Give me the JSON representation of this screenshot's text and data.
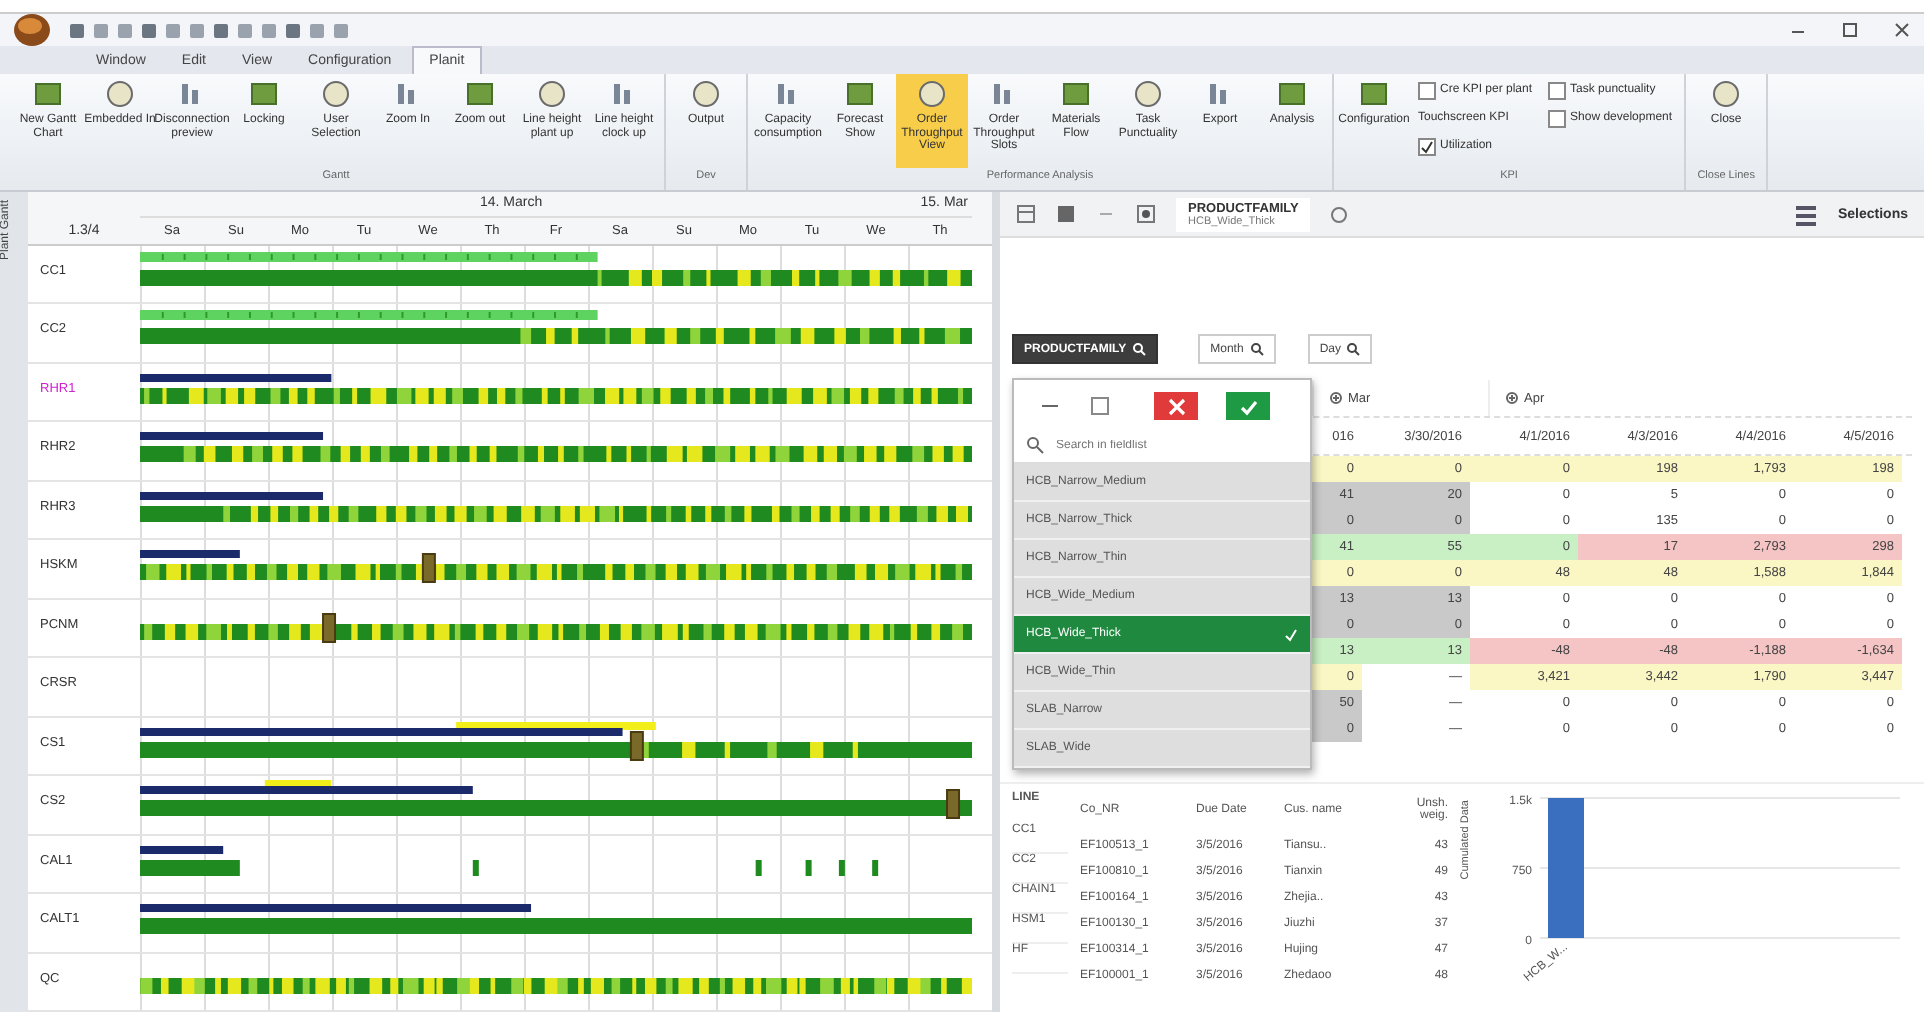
{
  "menu_tabs": [
    {
      "label": "Window",
      "selected": false
    },
    {
      "label": "Edit",
      "selected": false
    },
    {
      "label": "View",
      "selected": false
    },
    {
      "label": "Configuration",
      "selected": false
    },
    {
      "label": "Planit",
      "selected": true
    }
  ],
  "ribbon_groups": [
    {
      "title": "Gantt",
      "items": [
        {
          "kind": "button",
          "label": "New Gantt Chart",
          "active": false
        },
        {
          "kind": "button",
          "label": "Embedded In",
          "active": false
        },
        {
          "kind": "button",
          "label": "Disconnection preview",
          "active": false
        },
        {
          "kind": "button",
          "label": "Locking",
          "active": false
        },
        {
          "kind": "button",
          "label": "User Selection",
          "active": false
        },
        {
          "kind": "button",
          "label": "Zoom In",
          "active": false
        },
        {
          "kind": "button",
          "label": "Zoom out",
          "active": false
        },
        {
          "kind": "button",
          "label": "Line height plant up",
          "active": false
        },
        {
          "kind": "button",
          "label": "Line height clock up",
          "active": false
        }
      ]
    },
    {
      "title": "Dev",
      "items": [
        {
          "kind": "button",
          "label": "Output",
          "active": false
        }
      ]
    },
    {
      "title": "Performance Analysis",
      "items": [
        {
          "kind": "button",
          "label": "Capacity consumption",
          "active": false
        },
        {
          "kind": "button",
          "label": "Forecast Show",
          "active": false
        },
        {
          "kind": "button",
          "label": "Order Throughput View",
          "active": true
        },
        {
          "kind": "button",
          "label": "Order Throughput Slots",
          "active": false
        },
        {
          "kind": "button",
          "label": "Materials Flow",
          "active": false
        },
        {
          "kind": "button",
          "label": "Task Punctuality",
          "active": false
        },
        {
          "kind": "button",
          "label": "Export",
          "active": false
        },
        {
          "kind": "button",
          "label": "Analysis",
          "active": false
        }
      ]
    },
    {
      "title": "KPI",
      "items": [
        {
          "kind": "button",
          "label": "Configuration",
          "active": false
        },
        {
          "kind": "check",
          "label": "Cre KPI per plant",
          "checked": false
        },
        {
          "kind": "text",
          "label": "Touchscreen KPI"
        },
        {
          "kind": "check",
          "label": "Utilization",
          "checked": true
        },
        {
          "kind": "check",
          "label": "Task punctuality",
          "checked": false
        },
        {
          "kind": "check",
          "label": "Show development",
          "checked": false
        }
      ]
    },
    {
      "title": "Close Lines",
      "items": [
        {
          "kind": "button",
          "label": "Close",
          "active": false
        }
      ]
    }
  ],
  "gantt": {
    "side_tab": "Plant Gantt",
    "corner": "1.3/4",
    "month": "14. March",
    "next_month": "15. Mar",
    "days": [
      "Sa",
      "Su",
      "Mo",
      "Tu",
      "We",
      "Th",
      "Fr",
      "Sa",
      "Su",
      "Mo",
      "Tu",
      "We",
      "Th"
    ],
    "rows": [
      {
        "label": "CC1",
        "highlighted": false
      },
      {
        "label": "CC2",
        "highlighted": false
      },
      {
        "label": "RHR1",
        "highlighted": true
      },
      {
        "label": "RHR2",
        "highlighted": false
      },
      {
        "label": "RHR3",
        "highlighted": false
      },
      {
        "label": "HSKM",
        "highlighted": false
      },
      {
        "label": "PCNM",
        "highlighted": false
      },
      {
        "label": "CRSR",
        "highlighted": false
      },
      {
        "label": "CS1",
        "highlighted": false
      },
      {
        "label": "CS2",
        "highlighted": false
      },
      {
        "label": "CAL1",
        "highlighted": false
      },
      {
        "label": "CALT1",
        "highlighted": false
      },
      {
        "label": "QC",
        "highlighted": false
      }
    ]
  },
  "analysis": {
    "tabs": [
      {
        "title": "PRODUCTFAMILY",
        "subtitle": "HCB_Wide_Thick",
        "selected": true
      }
    ],
    "selections_button": "Selections",
    "fields": [
      {
        "label": "PRODUCTFAMILY",
        "kind": "row"
      },
      {
        "label": "Month",
        "kind": "column"
      },
      {
        "label": "Day",
        "kind": "column"
      }
    ],
    "column_groups": [
      {
        "label": "Mar"
      },
      {
        "label": "Apr"
      }
    ],
    "date_headers": [
      "016",
      "3/30/2016",
      "4/1/2016",
      "4/3/2016",
      "4/4/2016",
      "4/5/2016"
    ],
    "rows": [
      {
        "cells": [
          {
            "value": "0",
            "color": "#fbf7c4"
          },
          {
            "value": "0",
            "color": "#fbf7c4"
          },
          {
            "value": "0",
            "color": "#fbf7c4"
          },
          {
            "value": "198",
            "color": "#fbf7c4"
          },
          {
            "value": "1,793",
            "color": "#fbf7c4"
          },
          {
            "value": "198",
            "color": "#fbf7c4"
          }
        ]
      },
      {
        "cells": [
          {
            "value": "41",
            "color": "#c9c9c9"
          },
          {
            "value": "20",
            "color": "#c9c9c9"
          },
          {
            "value": "0"
          },
          {
            "value": "5"
          },
          {
            "value": "0"
          },
          {
            "value": "0"
          }
        ]
      },
      {
        "cells": [
          {
            "value": "0",
            "color": "#c9c9c9"
          },
          {
            "value": "0",
            "color": "#c9c9c9"
          },
          {
            "value": "0"
          },
          {
            "value": "135"
          },
          {
            "value": "0"
          },
          {
            "value": "0"
          }
        ]
      },
      {
        "cells": [
          {
            "value": "41",
            "color": "#c9f0c4"
          },
          {
            "value": "55",
            "color": "#c9f0c4"
          },
          {
            "value": "0",
            "color": "#c9f0c4"
          },
          {
            "value": "17",
            "color": "#f5c4c4"
          },
          {
            "value": "2,793",
            "color": "#f5c4c4"
          },
          {
            "value": "298",
            "color": "#f5c4c4"
          }
        ]
      },
      {
        "cells": [
          {
            "value": "0",
            "color": "#fbf7c4"
          },
          {
            "value": "0",
            "color": "#fbf7c4"
          },
          {
            "value": "48",
            "color": "#fbf7c4"
          },
          {
            "value": "48",
            "color": "#fbf7c4"
          },
          {
            "value": "1,588",
            "color": "#fbf7c4"
          },
          {
            "value": "1,844",
            "color": "#fbf7c4"
          }
        ]
      },
      {
        "cells": [
          {
            "value": "13",
            "color": "#c9c9c9"
          },
          {
            "value": "13",
            "color": "#c9c9c9"
          },
          {
            "value": "0"
          },
          {
            "value": "0"
          },
          {
            "value": "0"
          },
          {
            "value": "0"
          }
        ]
      },
      {
        "cells": [
          {
            "value": "0",
            "color": "#c9c9c9"
          },
          {
            "value": "0",
            "color": "#c9c9c9"
          },
          {
            "value": "0"
          },
          {
            "value": "0"
          },
          {
            "value": "0"
          },
          {
            "value": "0"
          }
        ]
      },
      {
        "cells": [
          {
            "value": "13",
            "color": "#c9f0c4"
          },
          {
            "value": "13",
            "color": "#c9f0c4"
          },
          {
            "value": "-48",
            "color": "#f5c4c4"
          },
          {
            "value": "-48",
            "color": "#f5c4c4"
          },
          {
            "value": "-1,188",
            "color": "#f5c4c4"
          },
          {
            "value": "-1,634",
            "color": "#f5c4c4"
          }
        ]
      },
      {
        "cells": [
          {
            "value": "0",
            "color": "#fbf7c4"
          },
          {
            "value": "—"
          },
          {
            "value": "3,421",
            "color": "#fbf7c4"
          },
          {
            "value": "3,442",
            "color": "#fbf7c4"
          },
          {
            "value": "1,790",
            "color": "#fbf7c4"
          },
          {
            "value": "3,447",
            "color": "#fbf7c4"
          }
        ]
      },
      {
        "cells": [
          {
            "value": "50",
            "color": "#c9c9c9"
          },
          {
            "value": "—"
          },
          {
            "value": "0"
          },
          {
            "value": "0"
          },
          {
            "value": "0"
          },
          {
            "value": "0"
          }
        ]
      },
      {
        "cells": [
          {
            "value": "0",
            "color": "#c9c9c9"
          },
          {
            "value": "—"
          },
          {
            "value": "0"
          },
          {
            "value": "0"
          },
          {
            "value": "0"
          },
          {
            "value": "0"
          }
        ]
      }
    ],
    "filter": {
      "search_placeholder": "Search in fieldlist",
      "items": [
        {
          "label": "HCB_Narrow_Medium",
          "selected": false
        },
        {
          "label": "HCB_Narrow_Thick",
          "selected": false
        },
        {
          "label": "HCB_Narrow_Thin",
          "selected": false
        },
        {
          "label": "HCB_Wide_Medium",
          "selected": false
        },
        {
          "label": "HCB_Wide_Thick",
          "selected": true
        },
        {
          "label": "HCB_Wide_Thin",
          "selected": false
        },
        {
          "label": "SLAB_Narrow",
          "selected": false
        },
        {
          "label": "SLAB_Wide",
          "selected": false
        }
      ]
    },
    "lines": {
      "title": "LINE",
      "items": [
        "CC1",
        "CC2",
        "CHAIN1",
        "HSM1",
        "HF"
      ]
    },
    "orders": {
      "columns": [
        "Co_NR",
        "Due Date",
        "Cus. name",
        "Unsh. weig."
      ],
      "rows": [
        [
          "EF100513_1",
          "3/5/2016",
          "Tiansu..",
          "43"
        ],
        [
          "EF100810_1",
          "3/5/2016",
          "Tianxin",
          "49"
        ],
        [
          "EF100164_1",
          "3/5/2016",
          "Zhejia..",
          "43"
        ],
        [
          "EF100130_1",
          "3/5/2016",
          "Jiuzhi",
          "37"
        ],
        [
          "EF100314_1",
          "3/5/2016",
          "Hujing",
          "47"
        ],
        [
          "EF100001_1",
          "3/5/2016",
          "Zhedaoo",
          "48"
        ]
      ]
    },
    "chart_data": {
      "type": "bar",
      "ylabel": "Cumulated Data",
      "categories": [
        "HCB_W..."
      ],
      "values": [
        1500
      ],
      "ylim": [
        0,
        1500
      ],
      "yticks": [
        {
          "value": 0,
          "label": "0"
        },
        {
          "value": 750,
          "label": "750"
        },
        {
          "value": 1500,
          "label": "1.5k"
        }
      ]
    }
  }
}
